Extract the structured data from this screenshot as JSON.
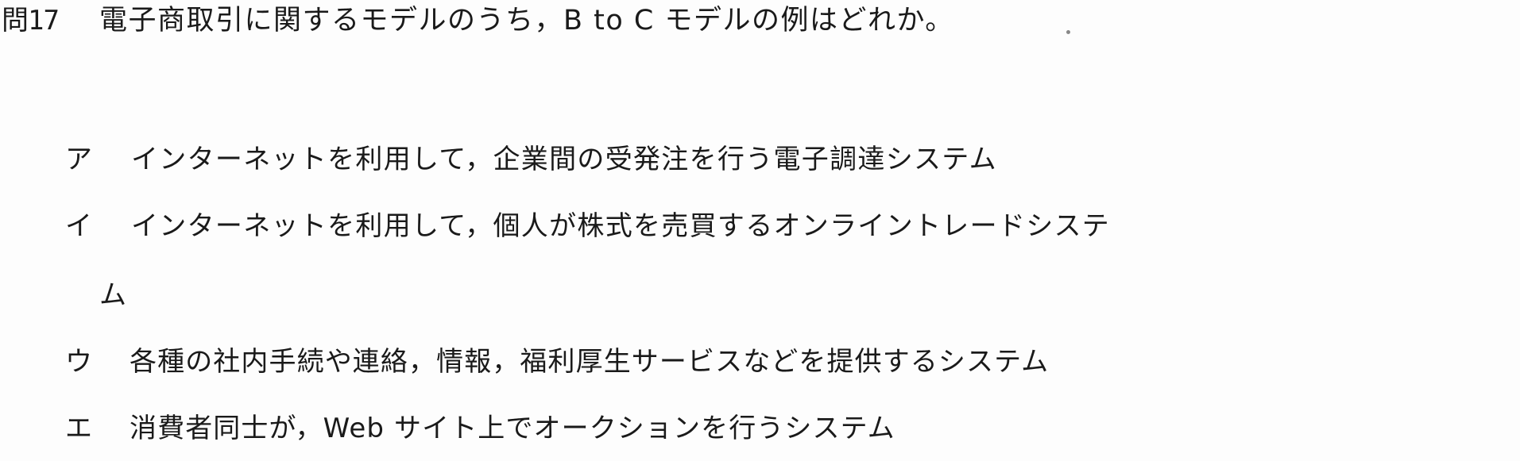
{
  "question": {
    "number": "問17",
    "text": "電子商取引に関するモデルのうち，B to C モデルの例はどれか。"
  },
  "choices": [
    {
      "label": "ア",
      "text": "インターネットを利用して，企業間の受発注を行う電子調達システム"
    },
    {
      "label": "イ",
      "text": "インターネットを利用して，個人が株式を売買するオンライントレードシステ",
      "continuation": "ム"
    },
    {
      "label": "ウ",
      "text": "各種の社内手続や連絡，情報，福利厚生サービスなどを提供するシステム"
    },
    {
      "label": "エ",
      "text": "消費者同士が，Web サイト上でオークションを行うシステム"
    }
  ]
}
